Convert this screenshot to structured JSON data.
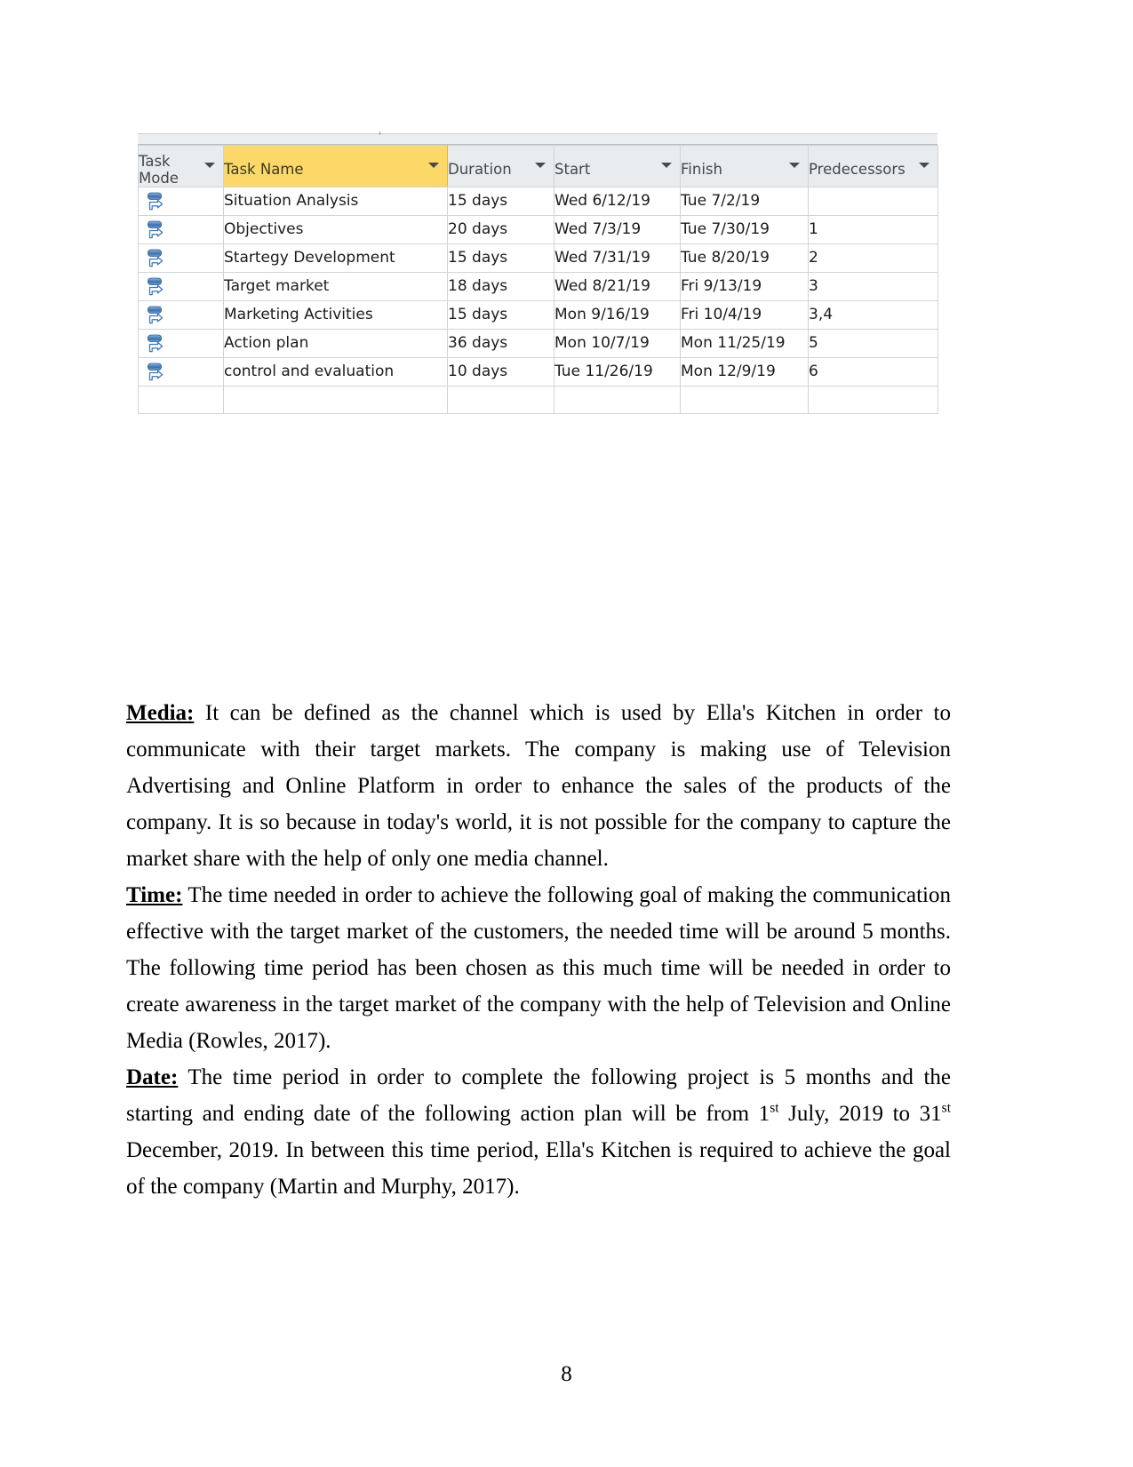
{
  "document": {
    "page_number": "8"
  },
  "project_table": {
    "columns": [
      {
        "key": "task_mode",
        "label": "Task\nMode",
        "has_sort_caret": true,
        "highlighted": false
      },
      {
        "key": "task_name",
        "label": "Task Name",
        "has_sort_caret": true,
        "highlighted": true
      },
      {
        "key": "duration",
        "label": "Duration",
        "has_sort_caret": true,
        "highlighted": false
      },
      {
        "key": "start",
        "label": "Start",
        "has_sort_caret": true,
        "highlighted": false
      },
      {
        "key": "finish",
        "label": "Finish",
        "has_sort_caret": true,
        "highlighted": false
      },
      {
        "key": "predecessors",
        "label": "Predecessors",
        "has_sort_caret": true,
        "highlighted": false
      }
    ],
    "header_highlight_color": "#fcd868",
    "header_background_color": "#e9ecef",
    "task_mode_icon": "manually-scheduled-icon",
    "rows": [
      {
        "task_mode": "manually-scheduled-icon",
        "task_name": "Situation Analysis",
        "duration": "15 days",
        "start": "Wed 6/12/19",
        "finish": "Tue 7/2/19",
        "predecessors": ""
      },
      {
        "task_mode": "manually-scheduled-icon",
        "task_name": "Objectives",
        "duration": "20 days",
        "start": "Wed 7/3/19",
        "finish": "Tue 7/30/19",
        "predecessors": "1"
      },
      {
        "task_mode": "manually-scheduled-icon",
        "task_name": "Startegy Development",
        "duration": "15 days",
        "start": "Wed 7/31/19",
        "finish": "Tue 8/20/19",
        "predecessors": "2"
      },
      {
        "task_mode": "manually-scheduled-icon",
        "task_name": "Target market",
        "duration": "18 days",
        "start": "Wed 8/21/19",
        "finish": "Fri 9/13/19",
        "predecessors": "3"
      },
      {
        "task_mode": "manually-scheduled-icon",
        "task_name": "Marketing Activities",
        "duration": "15 days",
        "start": "Mon 9/16/19",
        "finish": "Fri 10/4/19",
        "predecessors": "3,4"
      },
      {
        "task_mode": "manually-scheduled-icon",
        "task_name": "Action plan",
        "duration": "36 days",
        "start": "Mon 10/7/19",
        "finish": "Mon 11/25/19",
        "predecessors": "5"
      },
      {
        "task_mode": "manually-scheduled-icon",
        "task_name": "control and evaluation",
        "duration": "10 days",
        "start": "Tue 11/26/19",
        "finish": "Mon 12/9/19",
        "predecessors": "6"
      }
    ]
  },
  "paragraphs": {
    "media": {
      "lead": "Media:",
      "body": " It can be defined as the channel which is used by Ella's Kitchen in order to communicate with their target markets. The company is making use of Television Advertising and Online Platform in order to enhance the sales of the products of the company. It is so because in today's world, it is not possible for the company to capture the market share with the help of only one media channel."
    },
    "time": {
      "lead": "Time:",
      "body": " The time needed in order to achieve the following goal of making the communication effective with the target market of the customers, the needed time will be around 5 months. The following time period has been chosen as this much time will be needed in order to create awareness in the target market of the company with the help of Television and Online Media (Rowles, 2017)."
    },
    "date": {
      "lead": "Date:",
      "body_part1": " The time period in order to complete the following project is 5 months and the starting and ending date of the following action plan will be from 1",
      "sup1": "st",
      "body_part2": " July, 2019 to 31",
      "sup2": "st",
      "body_part3": " December, 2019. In between this time period, Ella's Kitchen is required to achieve the goal of the company (Martin and Murphy, 2017)."
    }
  }
}
